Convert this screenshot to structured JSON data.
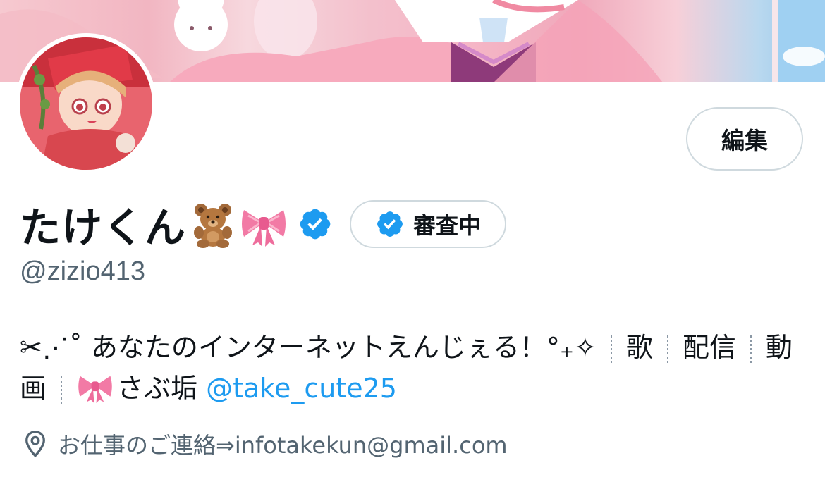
{
  "profile": {
    "name": "たけくん",
    "handle": "@zizio413",
    "edit_label": "編集",
    "review_label": "審査中",
    "bio": {
      "prefix": "✂︎⋰˚ あなたのインターネットえんじぇる！°₊✧",
      "sep_items": [
        "歌",
        "配信",
        "動画"
      ],
      "sub_label": "さぶ垢",
      "sub_link": "@take_cute25"
    },
    "location": "お仕事のご連絡⇒infotakekun@gmail.com"
  },
  "icons": {
    "verified": "verified-badge-icon",
    "location": "location-pin-icon",
    "bear": "teddy-bear-emoji",
    "ribbon": "ribbon-emoji"
  },
  "colors": {
    "accent": "#1d9bf0",
    "secondary_text": "#536471",
    "border": "#cfd9de"
  }
}
